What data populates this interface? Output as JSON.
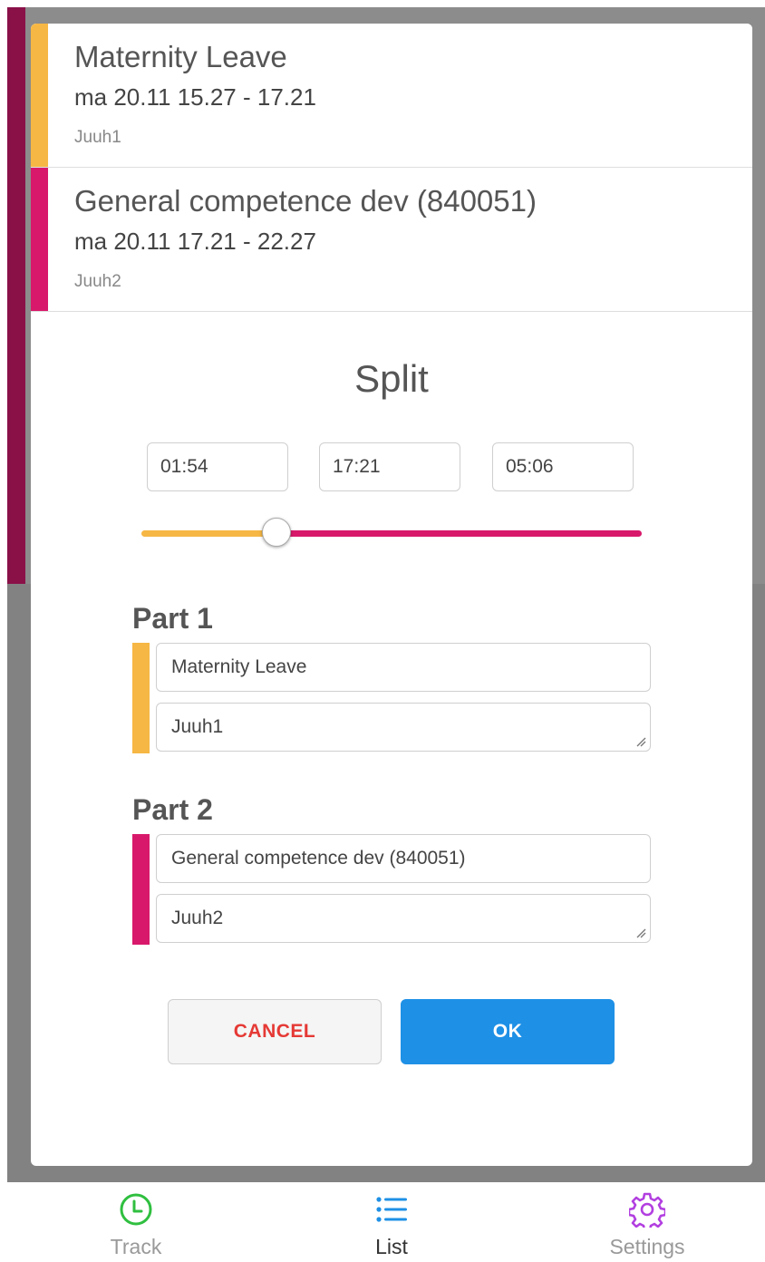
{
  "entries": [
    {
      "title": "Maternity Leave",
      "time": "ma 20.11 15.27 - 17.21",
      "note": "Juuh1",
      "color": "#f6b744"
    },
    {
      "title": "General competence dev (840051)",
      "time": "ma 20.11 17.21 - 22.27",
      "note": "Juuh2",
      "color": "#d8196b"
    }
  ],
  "split": {
    "title": "Split",
    "times": [
      "01:54",
      "17:21",
      "05:06"
    ],
    "slider_fraction": 0.27,
    "part1": {
      "label": "Part 1",
      "name": "Maternity Leave",
      "note": "Juuh1",
      "color": "#f6b744"
    },
    "part2": {
      "label": "Part 2",
      "name": "General competence dev (840051)",
      "note": "Juuh2",
      "color": "#d8196b"
    },
    "cancel_label": "CANCEL",
    "ok_label": "OK"
  },
  "tabs": [
    {
      "label": "Track",
      "icon": "clock-icon",
      "color": "#2fbf3f",
      "active": false
    },
    {
      "label": "List",
      "icon": "list-icon",
      "color": "#1e90e6",
      "active": true
    },
    {
      "label": "Settings",
      "icon": "gear-icon",
      "color": "#b23fe0",
      "active": false
    }
  ],
  "colors": {
    "accent": "#1e90e6",
    "danger": "#e53935",
    "part1": "#f6b744",
    "part2": "#d8196b"
  }
}
